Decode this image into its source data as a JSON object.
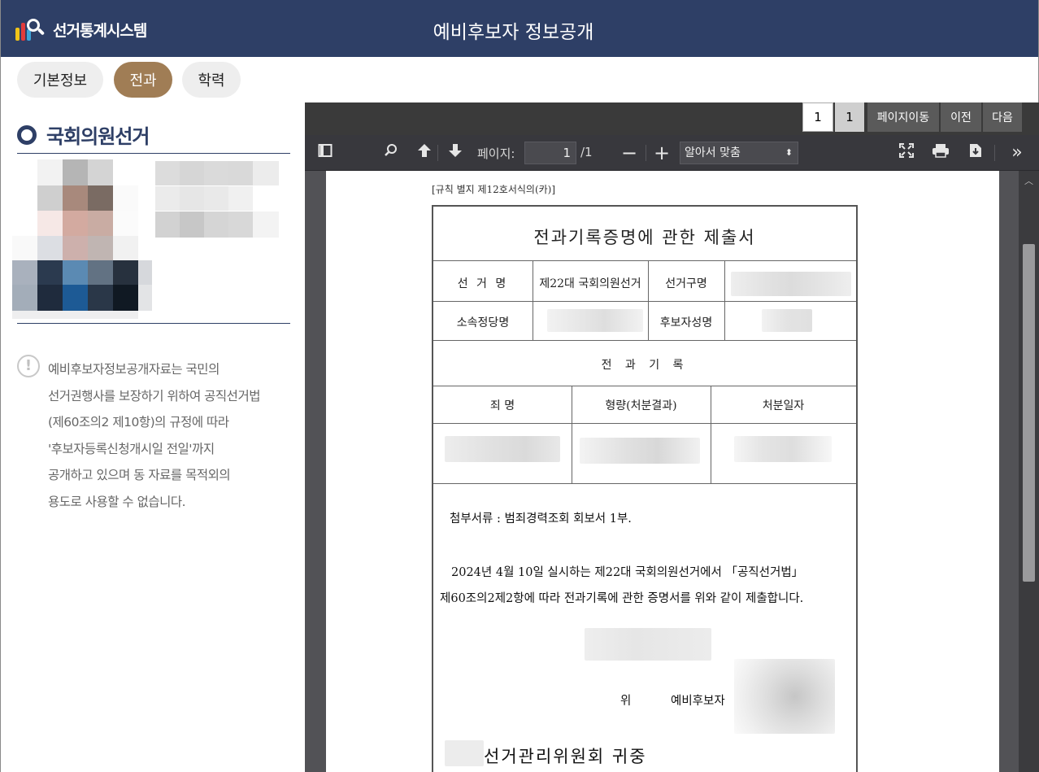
{
  "header": {
    "logo_text": "선거통계시스템",
    "title": "예비후보자 정보공개"
  },
  "tabs": [
    {
      "label": "기본정보",
      "active": false
    },
    {
      "label": "전과",
      "active": true
    },
    {
      "label": "학력",
      "active": false
    }
  ],
  "left": {
    "election_name": "국회의원선거",
    "notice_icon": "!",
    "notice_lines": [
      "예비후보자정보공개자료는 국민의",
      "선거권행사를 보장하기 위하여 공직선거법",
      "(제60조의2 제10항)의 규정에 따라",
      "'후보자등록신청개시일 전일'까지",
      "공개하고 있으며 동 자료를 목적외의",
      "용도로 사용할 수 없습니다."
    ]
  },
  "pagebar": {
    "current_page": "1",
    "total_pages": "1",
    "go_label": "페이지이동",
    "prev_label": "이전",
    "next_label": "다음"
  },
  "pdf_toolbar": {
    "page_label": "페이지:",
    "page_value": "1",
    "page_total": "/1",
    "zoom_value": "알아서 맞춤",
    "icons": [
      "sidebar-toggle-icon",
      "search-icon",
      "arrow-up-icon",
      "arrow-down-icon",
      "zoom-out-icon",
      "zoom-in-icon",
      "fullscreen-icon",
      "print-icon",
      "download-icon",
      "more-tools-icon"
    ]
  },
  "document": {
    "caption": "[규칙 별지 제12호서식의(카)]",
    "title": "전과기록증명에 관한 제출서",
    "label_election": "선  거  명",
    "value_election": "제22대 국회의원선거",
    "label_district": "선거구명",
    "label_party": "소속정당명",
    "label_candidate": "후보자성명",
    "section_record": "전  과  기  록",
    "col_crime": "죄    명",
    "col_sentence": "형량(처분결과)",
    "col_date": "처분일자",
    "attachment": "첨부서류 : 범죄경력조회 회보서 1부.",
    "statement_line1": "2024년 4월 10일 실시하는 제22대 국회의원선거에서 「공직선거법」",
    "statement_line2": "제60조의2제2항에 따라 전과기록에 관한 증명서를 위와 같이 제출합니다.",
    "signer_prefix": "위",
    "signer_role": "예비후보자",
    "addressee": "선거관리위원회  귀중"
  }
}
